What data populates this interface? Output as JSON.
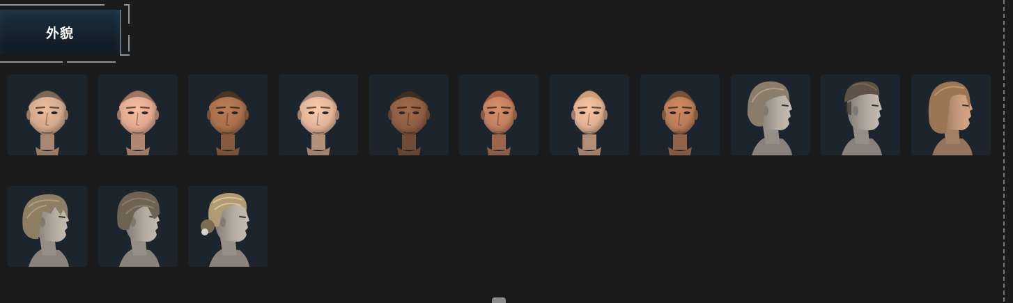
{
  "tab": {
    "label": "外貌"
  },
  "appearance_items": [
    {
      "icon": "male-bald-head-1",
      "skin": "#d3a98c",
      "hair": "#6a5a4c",
      "hair_style": "buzz",
      "view": "front",
      "gender": "male"
    },
    {
      "icon": "male-bald-head-2",
      "skin": "#dfa98f",
      "hair": "#8e6c58",
      "hair_style": "buzz",
      "view": "front",
      "gender": "male"
    },
    {
      "icon": "male-bald-head-3",
      "skin": "#a8704c",
      "hair": "#3a2a1e",
      "hair_style": "buzz",
      "view": "front",
      "gender": "male"
    },
    {
      "icon": "male-bald-head-4",
      "skin": "#e2b598",
      "hair": "#9c8270",
      "hair_style": "buzz",
      "view": "front",
      "gender": "male"
    },
    {
      "icon": "male-bald-head-5",
      "skin": "#8f5e42",
      "hair": "#2e241c",
      "hair_style": "buzz",
      "view": "front",
      "gender": "male"
    },
    {
      "icon": "female-bald-head-1",
      "skin": "#c2805f",
      "hair": "#a25b3e",
      "hair_style": "buzz",
      "view": "front",
      "gender": "female"
    },
    {
      "icon": "female-bald-head-2",
      "skin": "#e0b092",
      "hair": "#c69a72",
      "hair_style": "buzz",
      "view": "front",
      "gender": "female"
    },
    {
      "icon": "female-bald-head-3",
      "skin": "#b97c58",
      "hair": "#6d4a30",
      "hair_style": "buzz",
      "view": "front",
      "gender": "female"
    },
    {
      "icon": "bob-haircut-icon",
      "skin": "#b6ada2",
      "hair": "#8a7d6b",
      "hair_style": "bob",
      "view": "side",
      "gender": "female"
    },
    {
      "icon": "undercut-haircut-icon",
      "skin": "#b6ada2",
      "hair": "#5e5246",
      "hair_style": "undercut",
      "view": "side",
      "gender": "male"
    },
    {
      "icon": "lob-haircut-icon",
      "skin": "#c79b7c",
      "hair": "#9b7654",
      "hair_style": "lob",
      "view": "side",
      "gender": "female"
    },
    {
      "icon": "messy-bob-haircut-icon",
      "skin": "#b6ada2",
      "hair": "#8e7e63",
      "hair_style": "messy",
      "view": "side",
      "gender": "female"
    },
    {
      "icon": "curtain-bangs-haircut-icon",
      "skin": "#b6ada2",
      "hair": "#6e6353",
      "hair_style": "bangs",
      "view": "side",
      "gender": "male"
    },
    {
      "icon": "braided-updo-haircut-icon",
      "skin": "#b9afa4",
      "hair": "#b19a76",
      "hair_style": "updo",
      "view": "side",
      "gender": "female"
    }
  ]
}
